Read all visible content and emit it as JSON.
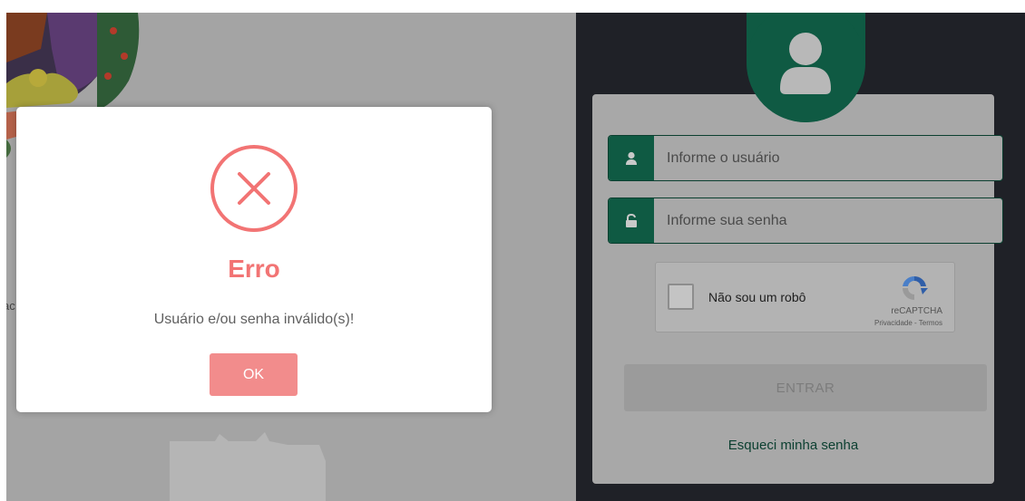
{
  "colors": {
    "overlay_left": "#a4a4a4",
    "overlay_right": "#1f2127",
    "brand_green": "#0f5a43",
    "error_red": "#f27474",
    "ok_button": "#f28c8c"
  },
  "background": {
    "left_cut_text": "ac",
    "crest_icon": "municipal-crest-icon"
  },
  "login": {
    "avatar_icon": "user-icon",
    "username": {
      "placeholder": "Informe o usuário",
      "icon": "user-icon"
    },
    "password": {
      "placeholder": "Informe sua senha",
      "icon": "unlock-icon"
    },
    "recaptcha": {
      "label": "Não sou um robô",
      "brand": "reCAPTCHA",
      "privacy": "Privacidade",
      "separator": " - ",
      "terms": "Termos"
    },
    "enter_label": "ENTRAR",
    "forgot_label": "Esqueci minha senha"
  },
  "modal": {
    "icon": "error-x-icon",
    "title": "Erro",
    "message": "Usuário e/ou senha inválido(s)!",
    "ok_label": "OK"
  }
}
